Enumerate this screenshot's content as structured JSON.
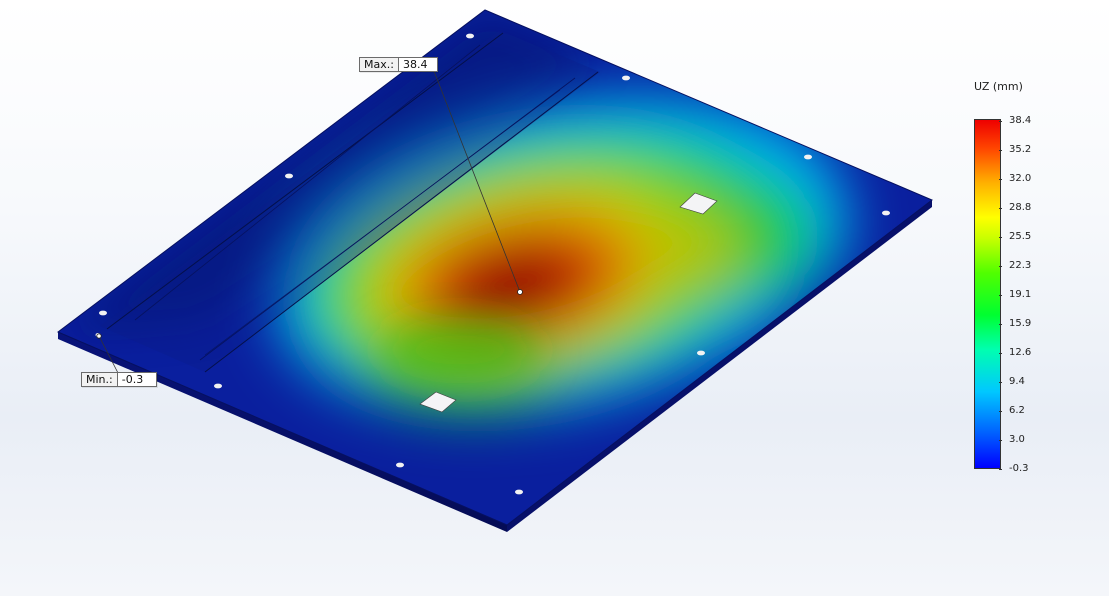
{
  "probes": {
    "max": {
      "tag": "Max.:",
      "value": "38.4"
    },
    "min": {
      "tag": "Min.:",
      "value": "-0.3"
    }
  },
  "legend": {
    "title": "UZ (mm)",
    "ticks": [
      "38.4",
      "35.2",
      "32.0",
      "28.8",
      "25.5",
      "22.3",
      "19.1",
      "15.9",
      "12.6",
      "9.4",
      "6.2",
      "3.0",
      "-0.3"
    ]
  },
  "colors": {
    "plate_base": "#0a1f9e",
    "hotspot": "#8b0000",
    "background": "#eef2f8"
  }
}
